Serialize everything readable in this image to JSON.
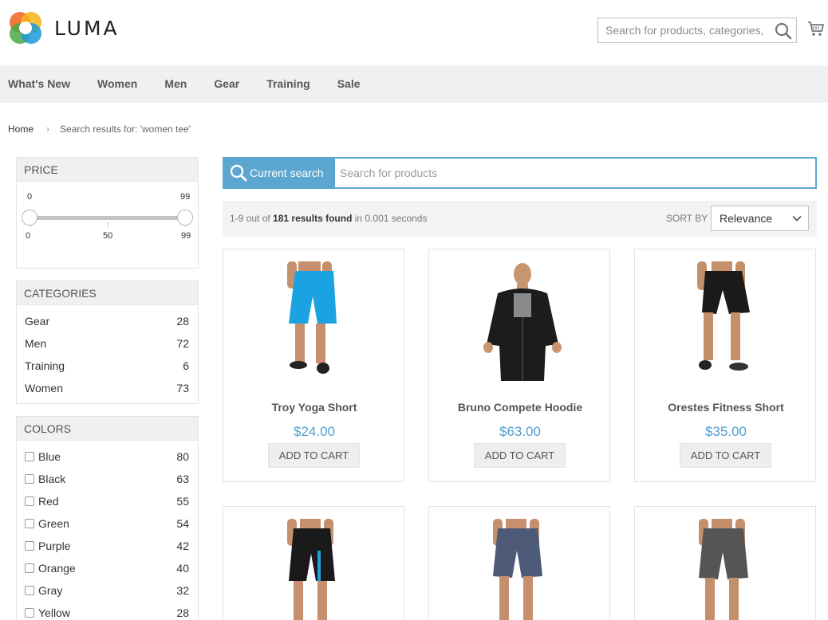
{
  "header": {
    "brand": "LUMA",
    "search_placeholder": "Search for products, categories, ..."
  },
  "nav": [
    "What's New",
    "Women",
    "Men",
    "Gear",
    "Training",
    "Sale"
  ],
  "breadcrumb": {
    "home": "Home",
    "separator": "›",
    "current": "Search results for: 'women tee'"
  },
  "price_facet": {
    "title": "PRICE",
    "min_value": "0",
    "max_value": "99",
    "scale": [
      "0",
      "50",
      "99"
    ]
  },
  "categories_facet": {
    "title": "CATEGORIES",
    "items": [
      {
        "label": "Gear",
        "count": "28"
      },
      {
        "label": "Men",
        "count": "72"
      },
      {
        "label": "Training",
        "count": "6"
      },
      {
        "label": "Women",
        "count": "73"
      }
    ]
  },
  "colors_facet": {
    "title": "COLORS",
    "items": [
      {
        "label": "Blue",
        "count": "80"
      },
      {
        "label": "Black",
        "count": "63"
      },
      {
        "label": "Red",
        "count": "55"
      },
      {
        "label": "Green",
        "count": "54"
      },
      {
        "label": "Purple",
        "count": "42"
      },
      {
        "label": "Orange",
        "count": "40"
      },
      {
        "label": "Gray",
        "count": "32"
      },
      {
        "label": "Yellow",
        "count": "28"
      }
    ]
  },
  "current_search": {
    "label": "Current search",
    "placeholder": "Search for products"
  },
  "results": {
    "range": "1-9 out of",
    "count_text": "181 results found",
    "time_text": "in 0.001 seconds",
    "sort_label": "SORT BY",
    "sort_value": "Relevance"
  },
  "products": [
    {
      "name": "Troy Yoga Short",
      "price": "$24.00",
      "button": "ADD TO CART",
      "image": "blue-shorts",
      "color": "#1aa3e0"
    },
    {
      "name": "Bruno Compete Hoodie",
      "price": "$63.00",
      "button": "ADD TO CART",
      "image": "black-hoodie",
      "color": "#1c1c1c"
    },
    {
      "name": "Orestes Fitness Short",
      "price": "$35.00",
      "button": "ADD TO CART",
      "image": "black-shorts",
      "color": "#1a1a1a"
    },
    {
      "name": "",
      "price": "",
      "button": "",
      "image": "black-blue-shorts",
      "color": "#1a1a1a"
    },
    {
      "name": "",
      "price": "",
      "button": "",
      "image": "slate-shorts",
      "color": "#4d5a78"
    },
    {
      "name": "",
      "price": "",
      "button": "",
      "image": "gray-shorts",
      "color": "#555555"
    }
  ],
  "colors": {
    "accent": "#5ba7d1",
    "price": "#4f9fcf",
    "nav_bg": "#f0f0f0"
  }
}
